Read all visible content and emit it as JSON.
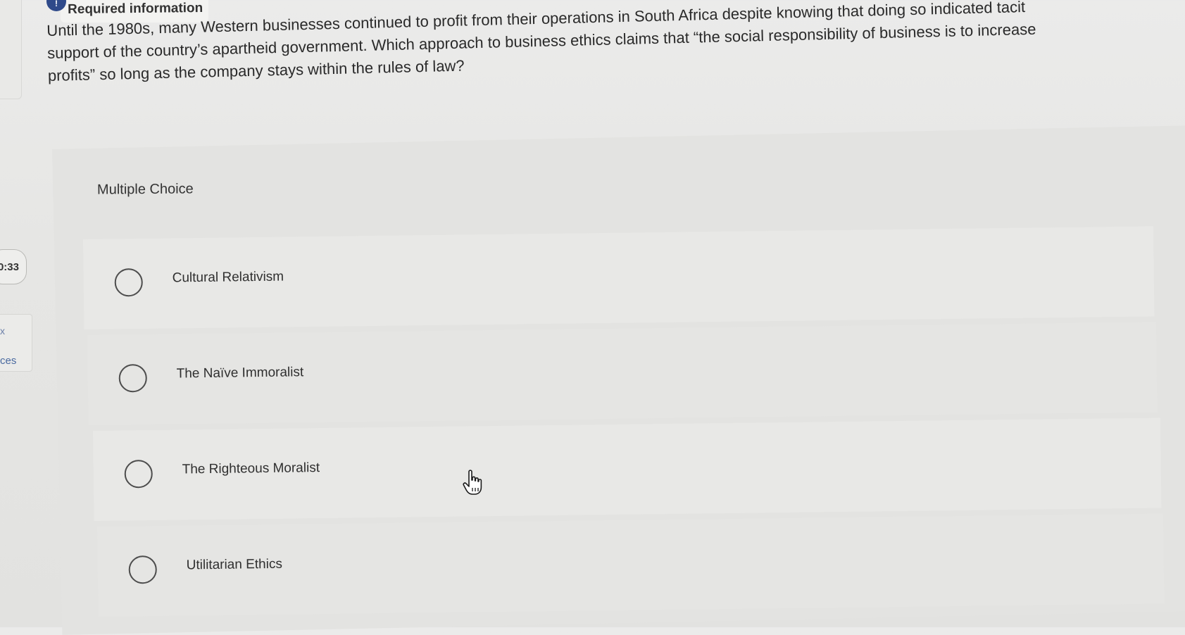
{
  "left_rail": {
    "timer_text": "0:33",
    "x_label": "x",
    "ces_label": "ces"
  },
  "header": {
    "required_icon": "!",
    "required_label": "Required information"
  },
  "question": {
    "lines": [
      "Until the 1980s, many Western businesses continued to profit from their operations in South Africa despite knowing that doing so indicated tacit",
      "support of the country’s apartheid government. Which approach to business ethics claims that “the social responsibility of business is to increase",
      "profits” so long as the company stays within the rules of law?"
    ]
  },
  "multiple_choice": {
    "label": "Multiple Choice",
    "options": [
      {
        "label": "Cultural Relativism",
        "selected": false
      },
      {
        "label": "The Naïve Immoralist",
        "selected": false
      },
      {
        "label": "The Righteous Moralist",
        "selected": false
      },
      {
        "label": "Utilitarian Ethics",
        "selected": false
      }
    ]
  },
  "cursor": {
    "icon": "hand-pointer-icon"
  }
}
